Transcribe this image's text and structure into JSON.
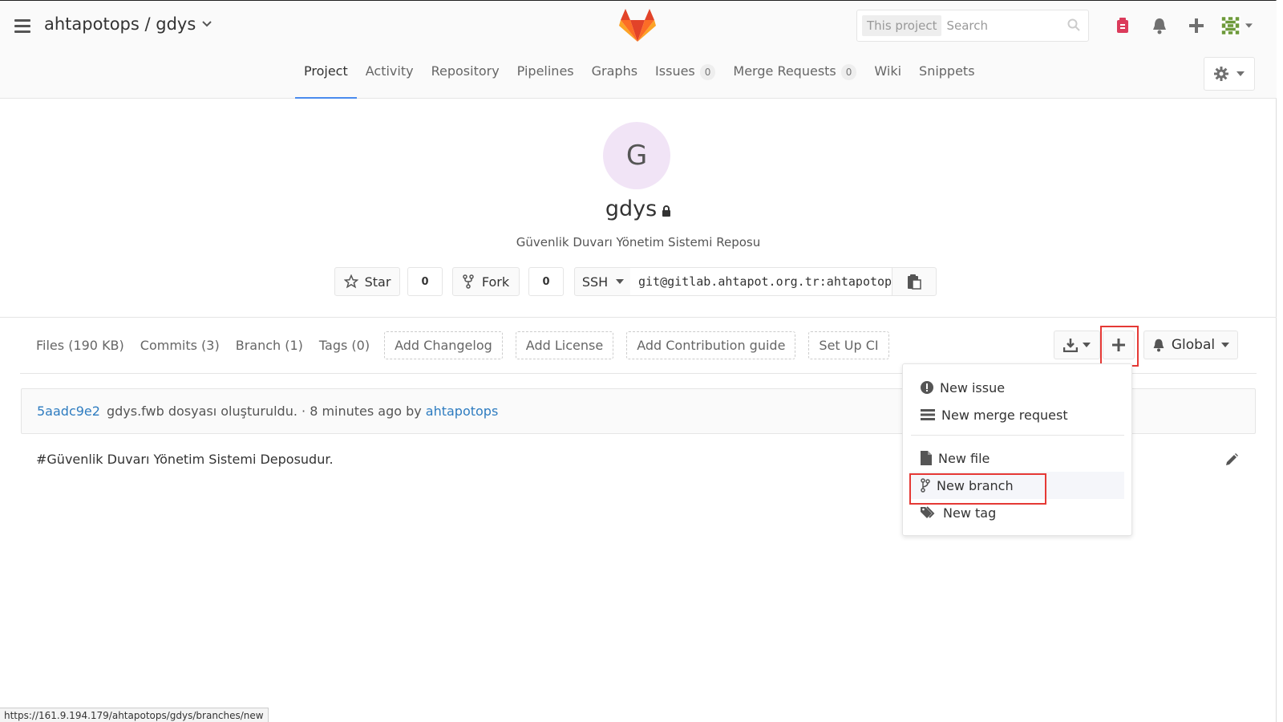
{
  "header": {
    "breadcrumb": "ahtapotops / gdys",
    "search_scope": "This project",
    "search_placeholder": "Search"
  },
  "nav": {
    "tabs": [
      {
        "label": "Project",
        "active": true
      },
      {
        "label": "Activity"
      },
      {
        "label": "Repository"
      },
      {
        "label": "Pipelines"
      },
      {
        "label": "Graphs"
      },
      {
        "label": "Issues",
        "count": "0"
      },
      {
        "label": "Merge Requests",
        "count": "0"
      },
      {
        "label": "Wiki"
      },
      {
        "label": "Snippets"
      }
    ]
  },
  "project": {
    "avatar_letter": "G",
    "name": "gdys",
    "description": "Güvenlik Duvarı Yönetim Sistemi Reposu",
    "star_label": "Star",
    "star_count": "0",
    "fork_label": "Fork",
    "fork_count": "0",
    "protocol": "SSH",
    "clone_url": "git@gitlab.ahtapot.org.tr:ahtapotops/gdys.git"
  },
  "stats": {
    "files": "Files (190 KB)",
    "commits": "Commits (3)",
    "branch": "Branch (1)",
    "tags": "Tags (0)",
    "add_changelog": "Add Changelog",
    "add_license": "Add License",
    "add_contribution": "Add Contribution guide",
    "setup_ci": "Set Up CI",
    "notification_level": "Global"
  },
  "commit": {
    "sha": "5aadc9e2",
    "message": "gdys.fwb dosyası oluşturuldu. · 8 minutes ago by",
    "author": "ahtapotops"
  },
  "readme": {
    "text": "#Güvenlik Duvarı Yönetim Sistemi Deposudur."
  },
  "dropdown": {
    "new_issue": "New issue",
    "new_merge_request": "New merge request",
    "new_file": "New file",
    "new_branch": "New branch",
    "new_tag": "New tag"
  },
  "statusbar": {
    "url": "https://161.9.194.179/ahtapotops/gdys/branches/new"
  },
  "colors": {
    "accent": "#4a8bee",
    "link": "#2e7cc0",
    "highlight": "#e53935",
    "todo": "#db3b5b"
  }
}
